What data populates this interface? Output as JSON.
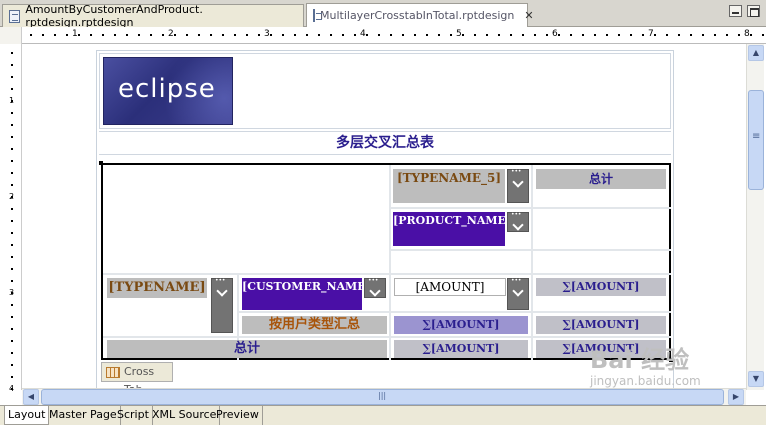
{
  "editor_tabs": [
    {
      "label": "AmountByCustomerAndProduct. rptdesign.rptdesign",
      "active": false
    },
    {
      "label": "MultilayerCrosstabInTotal.rptdesign",
      "active": true
    }
  ],
  "ruler": {
    "h_numbers": [
      "1",
      "2",
      "3",
      "4",
      "5",
      "6",
      "7",
      "8"
    ],
    "v_numbers": [
      "1",
      "2",
      "3",
      "4"
    ]
  },
  "report": {
    "logo_text": "eclipse",
    "title": "多层交叉汇总表",
    "crosstab": {
      "col_dim_1": "[TYPENAME_5]",
      "col_dim_2": "[PRODUCT_NAME]",
      "col_total": "总计",
      "row_dim_1": "[TYPENAME]",
      "row_dim_2": "[CUSTOMER_NAME]",
      "measure": "[AMOUNT]",
      "sum_measure": "∑[AMOUNT]",
      "subtotal_label": "按用户类型汇总",
      "grand_total_label": "总计"
    },
    "crosstab_tab_label": "Cross Tab"
  },
  "bottom_tabs": [
    "Layout",
    "Master Page",
    "Script",
    "XML Source",
    "Preview"
  ],
  "watermark": {
    "main": "Bai 经验",
    "url": "jingyan.baidu.com"
  },
  "icons": {
    "file": "rptdesign-file-icon",
    "close": "close-icon",
    "crosstab": "crosstab-icon"
  }
}
